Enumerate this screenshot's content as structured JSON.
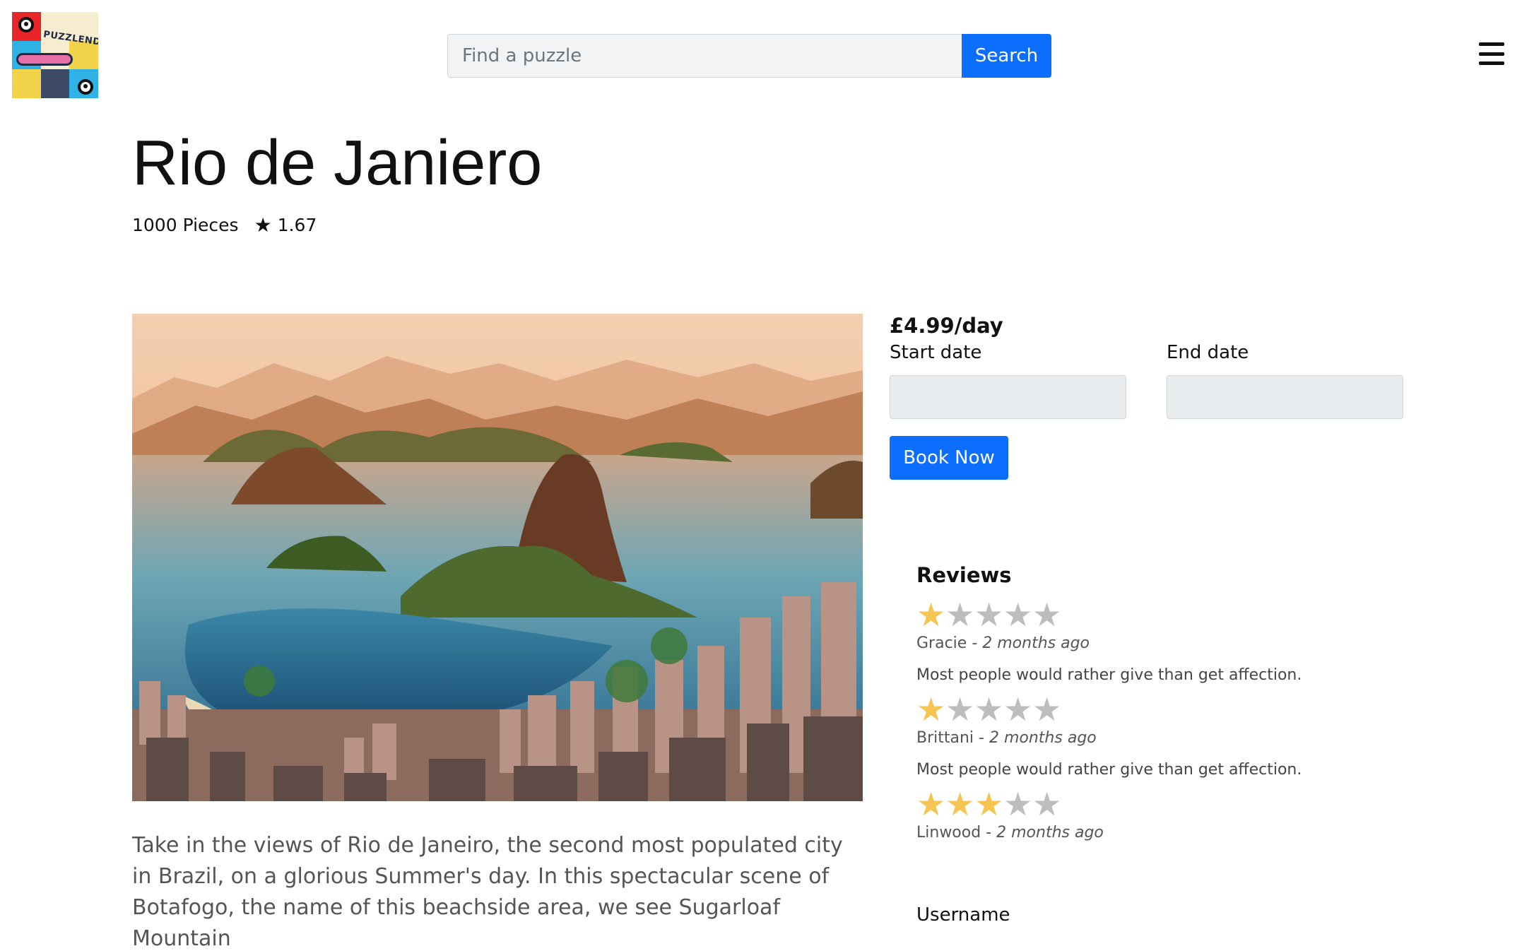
{
  "header": {
    "logo_text": "PUZZLEND",
    "search_placeholder": "Find a puzzle",
    "search_button": "Search"
  },
  "puzzle": {
    "title": "Rio de Janiero",
    "pieces": "1000 Pieces",
    "rating": "1.67",
    "description": "Take in the views of Rio de Janeiro, the second most populated city in Brazil, on a glorious Summer's day. In this spectacular scene of Botafogo, the name of this beachside area, we see Sugarloaf Mountain"
  },
  "booking": {
    "price": "£4.99/day",
    "start_label": "Start date",
    "end_label": "End date",
    "book_button": "Book Now"
  },
  "reviews": {
    "title": "Reviews",
    "items": [
      {
        "rating": 1,
        "author": "Gracie",
        "separator": " - ",
        "when": "2 months ago",
        "text": "Most people would rather give than get affection."
      },
      {
        "rating": 1,
        "author": "Brittani",
        "separator": " - ",
        "when": "2 months ago",
        "text": "Most people would rather give than get affection."
      },
      {
        "rating": 3,
        "author": "Linwood",
        "separator": " - ",
        "when": "2 months ago",
        "text": ""
      }
    ]
  },
  "form": {
    "username_label": "Username"
  },
  "colors": {
    "primary": "#0b6efd",
    "star_on": "#f6c453",
    "star_off": "#bdbdbd"
  },
  "icons": {
    "rating_star": "★",
    "menu": "hamburger-icon"
  }
}
